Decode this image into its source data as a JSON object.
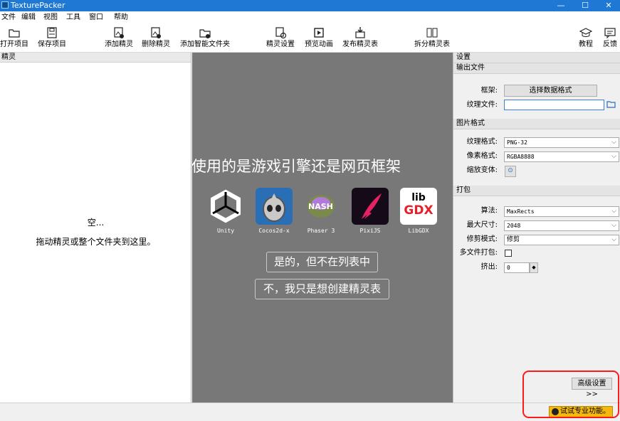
{
  "window": {
    "title": "TexturePacker",
    "minimize": "—",
    "maximize": "☐",
    "close": "✕"
  },
  "menu": [
    "文件",
    "编辑",
    "视图",
    "工具",
    "窗口",
    "帮助"
  ],
  "toolbar": {
    "open_project": "打开项目",
    "save_project": "保存项目",
    "add_sprite": "添加精灵",
    "remove_sprite": "删除精灵",
    "add_smart_folder": "添加智能文件夹",
    "sprite_settings": "精灵设置",
    "preview_anim": "预览动画",
    "publish": "发布精灵表",
    "split": "拆分精灵表",
    "tutorial": "教程",
    "feedback": "反馈"
  },
  "left_panel": {
    "header": "精灵",
    "empty_title": "空...",
    "empty_hint": "拖动精灵或整个文件夹到这里。"
  },
  "center": {
    "question": "您使用的是游戏引擎还是网页框架",
    "engines": [
      "Unity",
      "Cocos2d-x",
      "Phaser 3",
      "PixiJS",
      "LibGDX"
    ],
    "libgdx_logo_top": "lib",
    "libgdx_logo_bottom": "GDX",
    "phaser_logo": "NASH",
    "choice_yes": "是的，但不在列表中",
    "choice_no": "不，我只是想创建精灵表"
  },
  "settings": {
    "header": "设置",
    "output": {
      "header": "输出文件",
      "framework_label": "框架:",
      "framework_button": "选择数据格式",
      "texture_file_label": "纹理文件:",
      "texture_file_value": ""
    },
    "image_format": {
      "header": "图片格式",
      "texture_format_label": "纹理格式:",
      "texture_format_value": "PNG-32",
      "pixel_format_label": "像素格式:",
      "pixel_format_value": "RGBA8888",
      "scale_variant_label": "缩放变体:"
    },
    "packing": {
      "header": "打包",
      "algorithm_label": "算法:",
      "algorithm_value": "MaxRects",
      "max_size_label": "最大尺寸:",
      "max_size_value": "2048",
      "trim_mode_label": "修剪模式:",
      "trim_mode_value": "修剪",
      "multipack_label": "多文件打包:",
      "extrude_label": "挤出:",
      "extrude_value": "0"
    },
    "advanced_button": "高级设置>>"
  },
  "status": {
    "pro_button": "试试专业功能。"
  },
  "colors": {
    "titlebar": "#1e78d4",
    "center_bg": "#787878",
    "pro_button": "#f5b80f",
    "highlight": "#ff1a1a"
  }
}
